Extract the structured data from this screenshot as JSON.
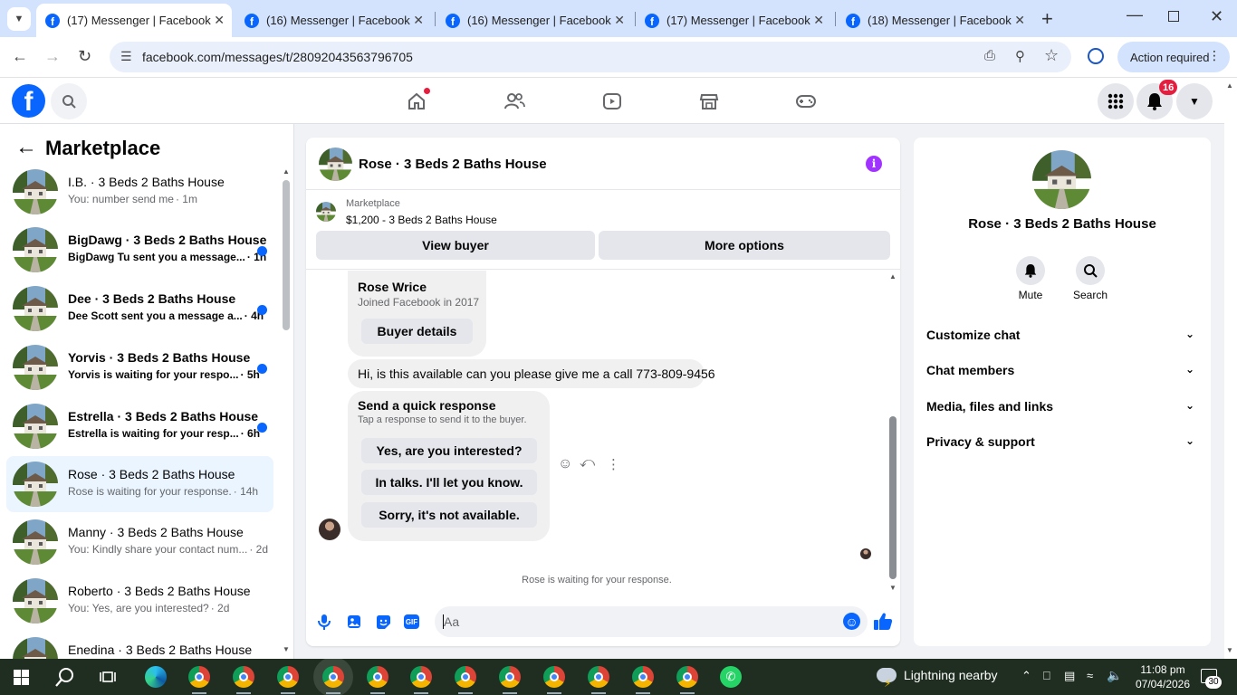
{
  "browser": {
    "tabs": [
      {
        "title": "(17) Messenger | Facebook",
        "active": true
      },
      {
        "title": "(16) Messenger | Facebook",
        "active": false
      },
      {
        "title": "(16) Messenger | Facebook",
        "active": false
      },
      {
        "title": "(17) Messenger | Facebook",
        "active": false
      },
      {
        "title": "(18) Messenger | Facebook",
        "active": false
      }
    ],
    "url": "facebook.com/messages/t/28092043563796705",
    "action_required": "Action required"
  },
  "fb": {
    "notification_count": "16"
  },
  "left_panel": {
    "title": "Marketplace",
    "conversations": [
      {
        "title": "I.B. · 3 Beds 2 Baths House",
        "preview": "You: number send me",
        "time": "· 1m",
        "unread": false,
        "selected": false
      },
      {
        "title": "BigDawg · 3 Beds 2 Baths House",
        "preview": "BigDawg Tu sent you a message...",
        "time": "· 1h",
        "unread": true,
        "selected": false
      },
      {
        "title": "Dee · 3 Beds 2 Baths House",
        "preview": "Dee Scott sent you a message a...",
        "time": "· 4h",
        "unread": true,
        "selected": false
      },
      {
        "title": "Yorvis · 3 Beds 2 Baths House",
        "preview": "Yorvis is waiting for your respo...",
        "time": "· 5h",
        "unread": true,
        "selected": false
      },
      {
        "title": "Estrella · 3 Beds 2 Baths House",
        "preview": "Estrella is waiting for your resp...",
        "time": "· 6h",
        "unread": true,
        "selected": false
      },
      {
        "title": "Rose · 3 Beds 2 Baths House",
        "preview": "Rose is waiting for your response.",
        "time": "· 14h",
        "unread": false,
        "selected": true
      },
      {
        "title": "Manny · 3 Beds 2 Baths House",
        "preview": "You: Kindly share your contact num...",
        "time": "· 2d",
        "unread": false,
        "selected": false
      },
      {
        "title": "Roberto · 3 Beds 2 Baths House",
        "preview": "You: Yes, are you interested?",
        "time": "· 2d",
        "unread": false,
        "selected": false
      },
      {
        "title": "Enedina · 3 Beds 2 Baths House",
        "preview": "",
        "time": "",
        "unread": false,
        "selected": false
      }
    ]
  },
  "chat": {
    "title": "Rose · 3 Beds 2 Baths House",
    "marketplace_label": "Marketplace",
    "listing": "$1,200 - 3 Beds 2 Baths House",
    "view_buyer": "View buyer",
    "more_options": "More options",
    "buyer_name": "Rose Wrice",
    "buyer_joined": "Joined Facebook in 2017",
    "buyer_details": "Buyer details",
    "message": "Hi, is this available can you please give me a call 773-809-9456",
    "quick_title": "Send a quick response",
    "quick_sub": "Tap a response to send it to the buyer.",
    "quick_responses": [
      "Yes, are you interested?",
      "In talks. I'll let you know.",
      "Sorry, it's not available."
    ],
    "status": "Rose is waiting for your response.",
    "input_placeholder": "Aa"
  },
  "right_panel": {
    "name": "Rose · 3 Beds 2 Baths House",
    "mute": "Mute",
    "search": "Search",
    "sections": [
      "Customize chat",
      "Chat members",
      "Media, files and links",
      "Privacy & support"
    ]
  },
  "taskbar": {
    "weather": "Lightning nearby",
    "time": "11:08 pm",
    "date": "07/04/2026",
    "notif_count": "30"
  },
  "colors": {
    "accent": "#0866ff",
    "purple": "#a033ff",
    "tab_bg": "#d3e3fd",
    "taskbar": "#1f2e20"
  }
}
